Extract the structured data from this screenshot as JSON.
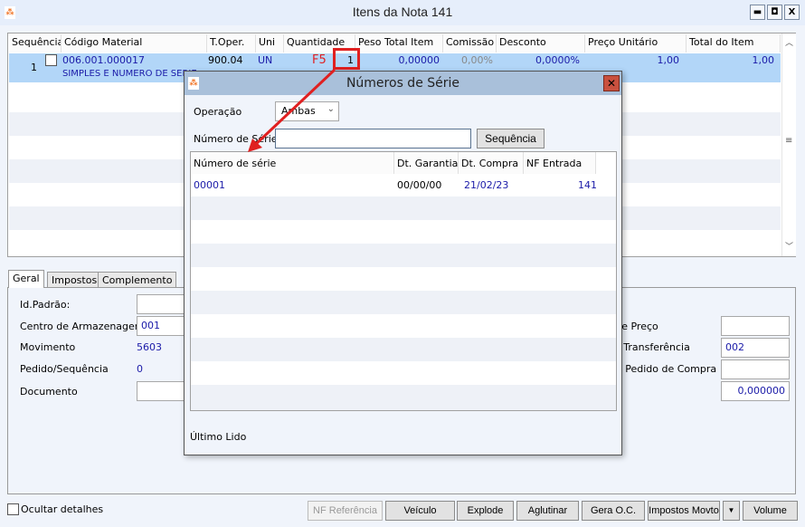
{
  "window": {
    "title": "Itens da Nota 141",
    "minimize": "▬",
    "maximize": "◘",
    "close": "X"
  },
  "grid": {
    "columns": [
      "Sequência",
      "Código Material",
      "T.Oper.",
      "Uni",
      "Quantidade",
      "Peso Total Item",
      "Comissão",
      "Desconto",
      "Preço Unitário",
      "Total do Item"
    ],
    "rows": [
      {
        "sequencia": "1",
        "codigo": "006.001.000017",
        "descricao": "SIMPLES E NUMERO DE SERIE",
        "toper": "900.04",
        "uni": "UN",
        "quantidade": "1",
        "peso": "0,00000",
        "comissao": "0,00%",
        "desconto": "0,0000%",
        "preco": "1,00",
        "total": "1,00"
      }
    ]
  },
  "annotation": {
    "key": "F5",
    "color": "#e02020"
  },
  "tabs": [
    "Geral",
    "Impostos",
    "Complemento"
  ],
  "form": {
    "id_padrao": "Id.Padrão:",
    "centro_label": "Centro de Armazenagem",
    "centro_value": "001",
    "movimento_label": "Movimento",
    "movimento_value": "5603",
    "pedido_label": "Pedido/Sequência",
    "pedido_value": "0",
    "documento_label": "Documento",
    "right_labels": [
      "a de Preço",
      "de Transferência",
      "do Pedido de Compra"
    ],
    "transferencia_value": "002",
    "last_value": "0,000000"
  },
  "dialog": {
    "title": "Números de Série",
    "operacao_label": "Operação",
    "operacao_value": "Ambas",
    "numero_label": "Número de Série",
    "numero_value": "",
    "sequencia_button": "Sequência",
    "columns": [
      "Número de série",
      "Dt. Garantia",
      "Dt. Compra",
      "NF Entrada"
    ],
    "rows": [
      {
        "numero": "00001",
        "garantia": "00/00/00",
        "compra": "21/02/23",
        "nf": "141"
      }
    ],
    "ultimo_lido": "Último Lido"
  },
  "footer": {
    "ocultar": "Ocultar detalhes",
    "buttons": [
      "NF Referência",
      "Veículo",
      "Explode",
      "Aglutinar",
      "Gera O.C.",
      "Impostos Movto",
      "Volume"
    ]
  }
}
